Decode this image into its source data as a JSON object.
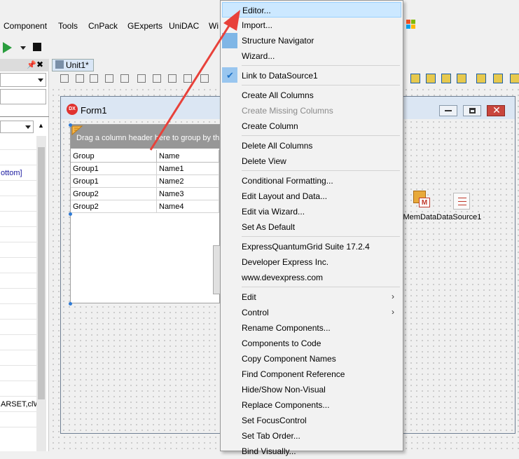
{
  "menubar": {
    "items": [
      "Component",
      "Tools",
      "CnPack",
      "GExperts",
      "UniDAC",
      "Wi"
    ]
  },
  "left_panel": {
    "rows": [
      "",
      "",
      "ottom]",
      "",
      "",
      "",
      "",
      "",
      "",
      "",
      "",
      "",
      "",
      "",
      "",
      "",
      "",
      "ARSET,clW",
      ""
    ]
  },
  "tab": {
    "label": "Unit1*"
  },
  "form": {
    "title": "Form1",
    "icon_label": "DX",
    "grid": {
      "group_panel_text": "Drag a column header here to group by th",
      "columns": [
        "Group",
        "Name"
      ],
      "rows": [
        [
          "Group1",
          "Name1"
        ],
        [
          "Group1",
          "Name2"
        ],
        [
          "Group2",
          "Name3"
        ],
        [
          "Group2",
          "Name4"
        ]
      ]
    },
    "nonvisual_label": "xMemDataDataSource1",
    "nonvisual_icon_text": "M"
  },
  "context_menu": {
    "highlighted_index": 0,
    "items": [
      {
        "label": "Editor...",
        "type": "item",
        "highlighted": true
      },
      {
        "label": "Import...",
        "type": "item"
      },
      {
        "label": "Structure Navigator",
        "type": "item"
      },
      {
        "label": "Wizard...",
        "type": "item"
      },
      {
        "type": "separator"
      },
      {
        "label": "Link to DataSource1",
        "type": "item",
        "checked": true
      },
      {
        "type": "separator"
      },
      {
        "label": "Create All Columns",
        "type": "item"
      },
      {
        "label": "Create Missing Columns",
        "type": "item",
        "disabled": true
      },
      {
        "label": "Create Column",
        "type": "item"
      },
      {
        "type": "separator"
      },
      {
        "label": "Delete All Columns",
        "type": "item"
      },
      {
        "label": "Delete View",
        "type": "item"
      },
      {
        "type": "separator"
      },
      {
        "label": "Conditional Formatting...",
        "type": "item"
      },
      {
        "label": "Edit Layout and Data...",
        "type": "item"
      },
      {
        "label": "Edit via Wizard...",
        "type": "item"
      },
      {
        "label": "Set As Default",
        "type": "item"
      },
      {
        "type": "separator"
      },
      {
        "label": "ExpressQuantumGrid Suite 17.2.4",
        "type": "item"
      },
      {
        "label": "Developer Express Inc.",
        "type": "item"
      },
      {
        "label": "www.devexpress.com",
        "type": "item"
      },
      {
        "type": "separator"
      },
      {
        "label": "Edit",
        "type": "item",
        "submenu": true
      },
      {
        "label": "Control",
        "type": "item",
        "submenu": true
      },
      {
        "label": "Rename Components...",
        "type": "item"
      },
      {
        "label": "Components to Code",
        "type": "item"
      },
      {
        "label": "Copy Component Names",
        "type": "item"
      },
      {
        "label": "Find Component Reference",
        "type": "item"
      },
      {
        "label": "Hide/Show Non-Visual",
        "type": "item"
      },
      {
        "label": "Replace Components...",
        "type": "item"
      },
      {
        "label": "Set FocusControl",
        "type": "item"
      },
      {
        "label": "Set Tab Order...",
        "type": "item"
      },
      {
        "label": "Bind Visually...",
        "type": "item"
      }
    ]
  },
  "colors": {
    "menu_highlight": "#cce8ff",
    "annotation_arrow": "#e8413a",
    "group_panel": "#979797",
    "play": "#2a9d3e"
  },
  "icons": {
    "run": "play-icon",
    "stop": "stop-icon",
    "pin": "pin-icon",
    "close": "close-icon",
    "check": "check-icon",
    "submenu": "chevron-right-icon"
  }
}
